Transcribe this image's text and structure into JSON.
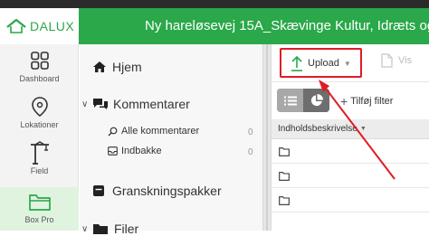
{
  "header": {
    "logo_text": "DALUX",
    "project_title": "Ny hareløsevej 15A_Skævinge Kultur, Idræts og"
  },
  "rail": {
    "items": [
      {
        "label": "Dashboard",
        "icon": "grid-icon"
      },
      {
        "label": "Lokationer",
        "icon": "location-pin-icon"
      },
      {
        "label": "Field",
        "icon": "crane-icon"
      },
      {
        "label": "Box Pro",
        "icon": "folder-icon"
      }
    ],
    "active": "Box Pro"
  },
  "nav": {
    "home": "Hjem",
    "comments": "Kommentarer",
    "all_comments": "Alle kommentarer",
    "all_comments_count": "0",
    "inbox": "Indbakke",
    "inbox_count": "0",
    "review_packages": "Granskningspakker",
    "files": "Filer"
  },
  "toolbar": {
    "upload_label": "Upload",
    "view_label": "Vis",
    "add_filter_label": "Tilføj filter"
  },
  "table": {
    "column_header": "Indholdsbeskrivelse",
    "rows": 3
  },
  "colors": {
    "brand_green": "#2aa84a",
    "highlight_red": "#e01b24"
  }
}
